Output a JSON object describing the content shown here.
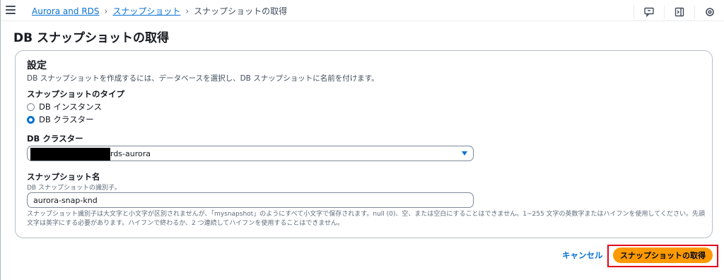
{
  "breadcrumb": {
    "items": [
      "Aurora and RDS",
      "スナップショット"
    ],
    "current": "スナップショットの取得"
  },
  "icons": [
    "menu-icon",
    "feedback-icon",
    "panel-icon",
    "settings-icon"
  ],
  "page": {
    "title": "DB スナップショットの取得"
  },
  "settings": {
    "title": "設定",
    "description": "DB スナップショットを作成するには、データベースを選択し、DB スナップショットに名前を付けます。",
    "type_label": "スナップショットのタイプ",
    "options": [
      "DB インスタンス",
      "DB クラスター"
    ],
    "selected_option": "DB クラスター",
    "cluster_label": "DB クラスター",
    "cluster_value": "rds-aurora",
    "name_label": "スナップショット名",
    "name_hint": "DB スナップショットの識別子。",
    "name_value": "aurora-snap-knd",
    "constraint": "スナップショット識別子は大文字と小文字が区別されませんが、「mysnapshot」のようにすべて小文字で保存されます。null (0)、空、または空白にすることはできません。1~255 文字の英数字またはハイフンを使用してください。先頭文字は英字にする必要があります。ハイフンで終わるか、2 つ連続してハイフンを使用することはできません。"
  },
  "actions": {
    "cancel": "キャンセル",
    "submit": "スナップショットの取得"
  },
  "colors": {
    "accent": "#0972d3",
    "primary_button": "#ff9900",
    "highlight": "#e2001a"
  }
}
